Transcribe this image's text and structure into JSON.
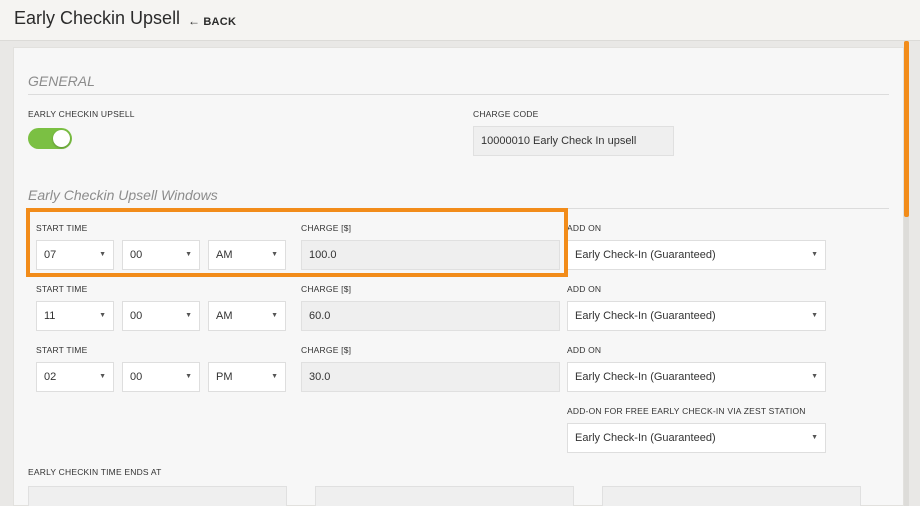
{
  "header": {
    "title": "Early Checkin Upsell",
    "back_label": "BACK",
    "back_icon": "arrow-left-icon"
  },
  "general": {
    "title": "GENERAL",
    "upsell_label": "EARLY CHECKIN UPSELL",
    "upsell_enabled": true,
    "toggle_color": "#7bc043",
    "charge_code_label": "CHARGE CODE",
    "charge_code_value": "10000010 Early Check In upsell"
  },
  "windows": {
    "title": "Early Checkin Upsell Windows",
    "highlight_color": "#f28c1a",
    "rows": [
      {
        "start_time_label": "START TIME",
        "hour": "07",
        "minute": "00",
        "ampm": "AM",
        "charge_label": "CHARGE [$]",
        "charge": "100.0",
        "addon_label": "ADD ON",
        "addon": "Early Check-In (Guaranteed)"
      },
      {
        "start_time_label": "START TIME",
        "hour": "11",
        "minute": "00",
        "ampm": "AM",
        "charge_label": "CHARGE [$]",
        "charge": "60.0",
        "addon_label": "ADD ON",
        "addon": "Early Check-In (Guaranteed)"
      },
      {
        "start_time_label": "START TIME",
        "hour": "02",
        "minute": "00",
        "ampm": "PM",
        "charge_label": "CHARGE [$]",
        "charge": "30.0",
        "addon_label": "ADD ON",
        "addon": "Early Check-In (Guaranteed)"
      }
    ],
    "zest_label": "ADD-ON FOR FREE EARLY CHECK-IN VIA ZEST STATION",
    "zest_value": "Early Check-In (Guaranteed)",
    "ends_label": "EARLY CHECKIN TIME ENDS AT"
  },
  "colors": {
    "accent": "#f28c1a"
  }
}
